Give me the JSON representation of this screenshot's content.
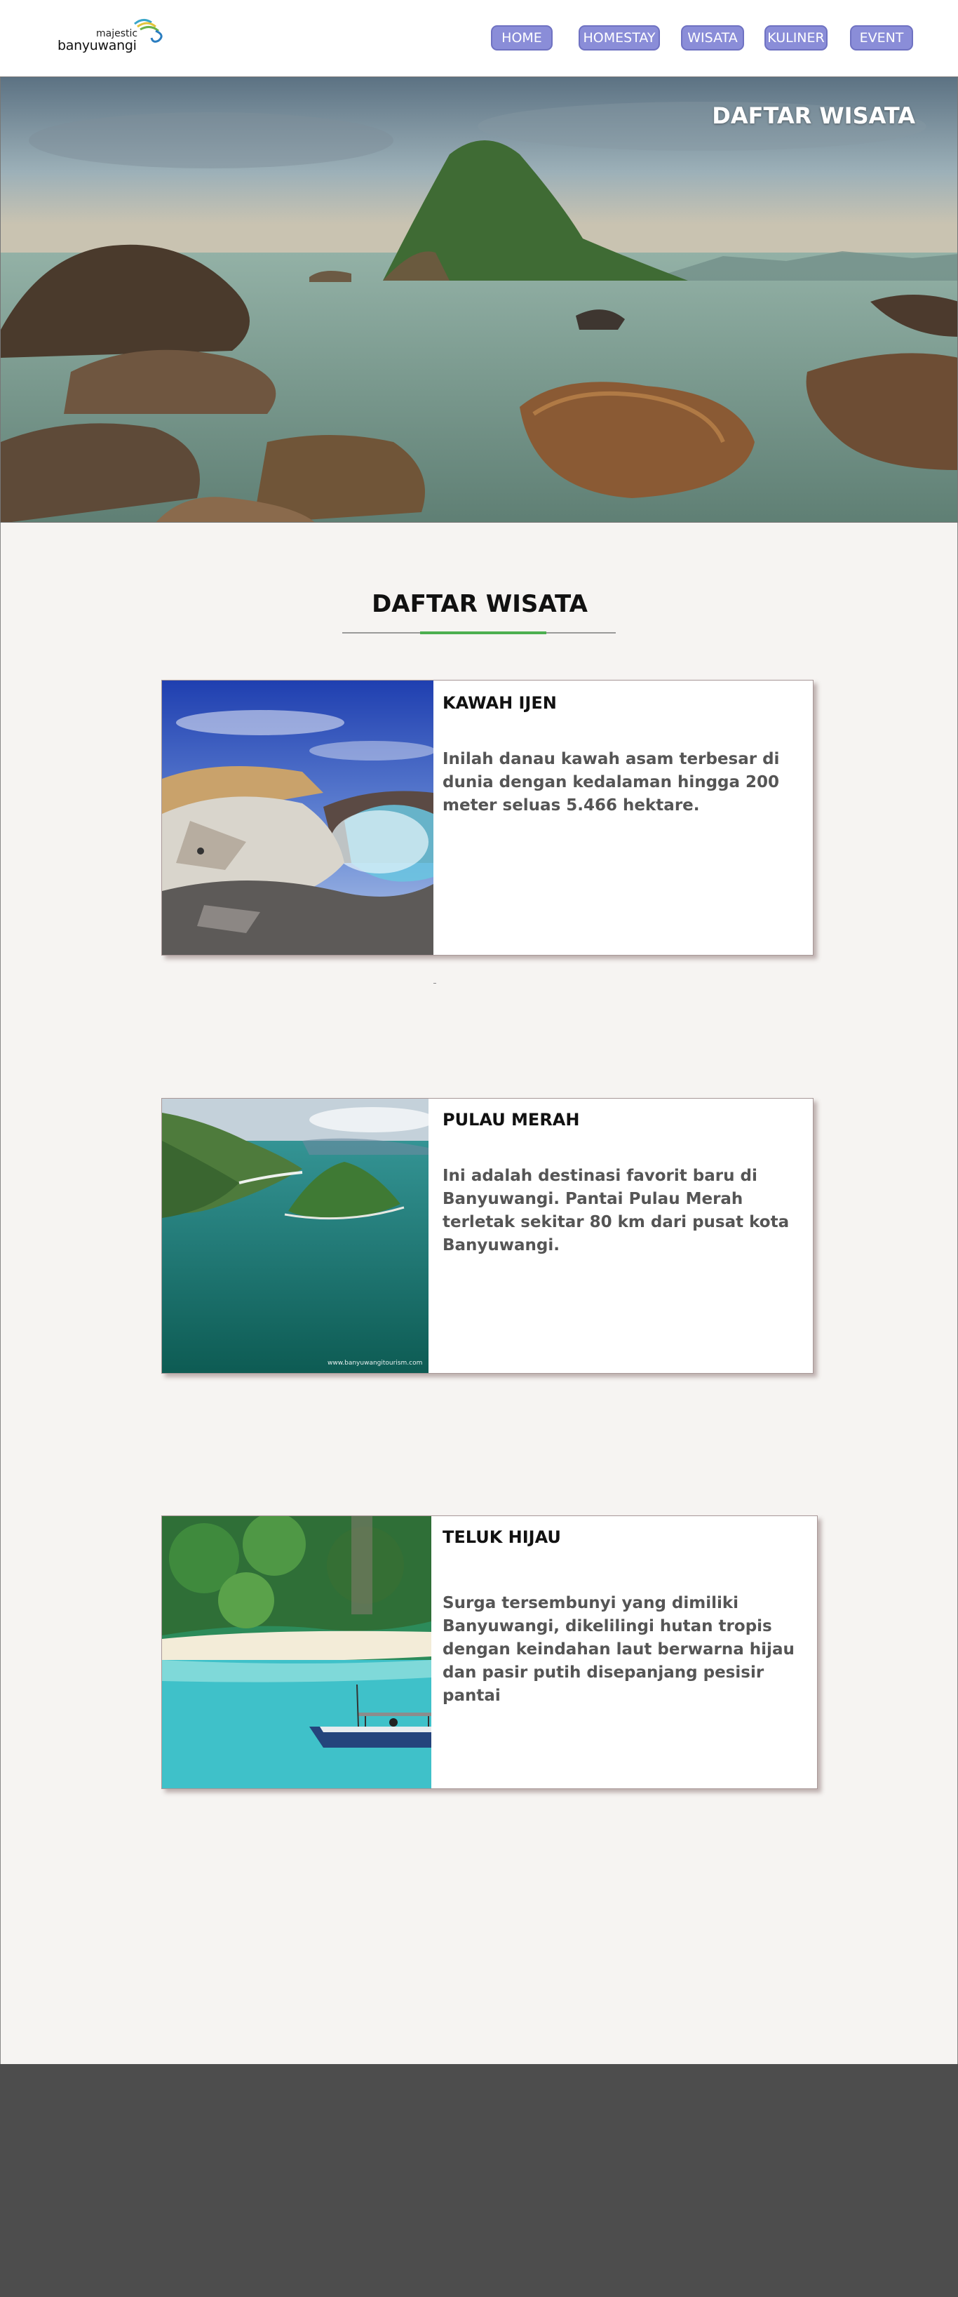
{
  "logo": {
    "small": "majestic",
    "big": "banyuwangi"
  },
  "nav": [
    {
      "label": "HOME"
    },
    {
      "label": "HOMESTAY"
    },
    {
      "label": "WISATA"
    },
    {
      "label": "KULINER"
    },
    {
      "label": "EVENT"
    }
  ],
  "hero": {
    "title": "DAFTAR WISATA"
  },
  "main": {
    "title": "DAFTAR WISATA"
  },
  "cards": [
    {
      "name": "KAWAH IJEN",
      "desc": "Inilah danau kawah asam terbesar di dunia dengan kedalaman hingga 200 meter seluas 5.466 hektare."
    },
    {
      "name": "PULAU MERAH",
      "desc": "Ini adalah destinasi favorit baru di Banyuwangi. Pantai Pulau Merah terletak sekitar 80 km dari pusat kota Banyuwangi.",
      "image_caption": "www.banyuwangitourism.com"
    },
    {
      "name": "TELUK HIJAU",
      "desc": "Surga tersembunyi yang dimiliki Banyuwangi, dikelilingi hutan tropis dengan keindahan laut berwarna hijau dan pasir putih disepanjang pesisir pantai"
    }
  ],
  "colors": {
    "nav_button": "#8a8dd8",
    "accent": "#4caf50",
    "footer": "#4d4d4d",
    "page_bg": "#f6f4f2"
  }
}
